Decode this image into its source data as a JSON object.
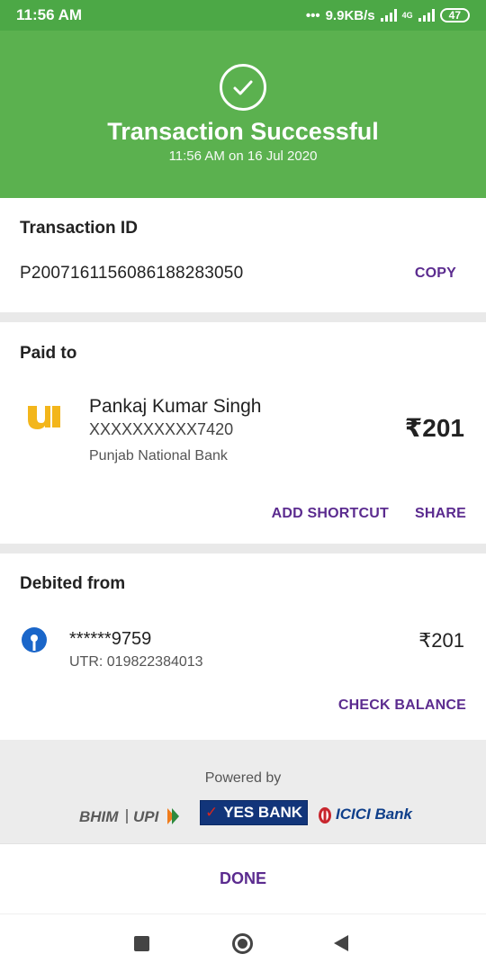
{
  "status_bar": {
    "time": "11:56 AM",
    "speed": "9.9KB/s",
    "network": "4G",
    "battery": "47"
  },
  "header": {
    "title": "Transaction Successful",
    "subtitle": "11:56 AM on 16 Jul 2020",
    "icon": "check-circle-icon"
  },
  "transaction": {
    "label": "Transaction ID",
    "id": "P2007161156086188283050",
    "copy_label": "COPY"
  },
  "paid_to": {
    "label": "Paid to",
    "name": "Pankaj Kumar Singh",
    "account": "XXXXXXXXXX7420",
    "bank": "Punjab National Bank",
    "amount": "₹201",
    "add_shortcut_label": "ADD SHORTCUT",
    "share_label": "SHARE"
  },
  "debited_from": {
    "label": "Debited from",
    "account": "******9759",
    "utr": "UTR: 019822384013",
    "amount": "₹201",
    "check_balance_label": "CHECK BALANCE"
  },
  "powered_by": {
    "label": "Powered by",
    "yes_bank": "YES BANK",
    "icici_bank": "ICICI Bank"
  },
  "done_label": "DONE",
  "colors": {
    "header_green": "#5bb14f",
    "status_green": "#4ca846",
    "accent_purple": "#5b2b8f"
  }
}
